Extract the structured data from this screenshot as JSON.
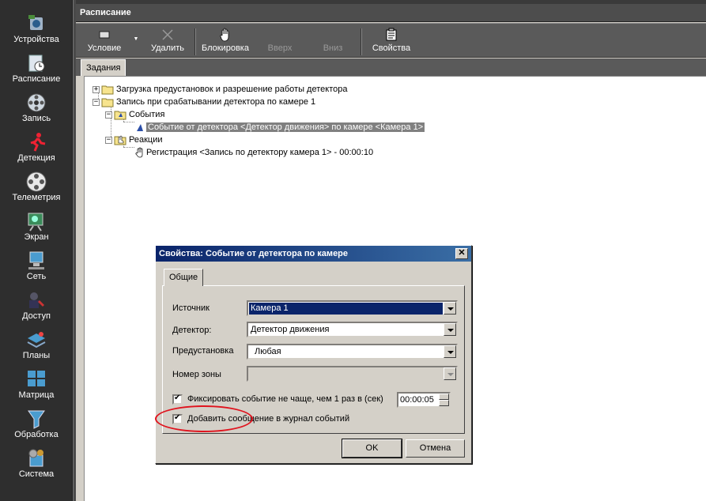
{
  "sidebar": {
    "items": [
      {
        "label": "Устройства",
        "icon": "devices-icon"
      },
      {
        "label": "Расписание",
        "icon": "schedule-icon"
      },
      {
        "label": "Запись",
        "icon": "record-icon"
      },
      {
        "label": "Детекция",
        "icon": "detection-icon"
      },
      {
        "label": "Телеметрия",
        "icon": "telemetry-icon"
      },
      {
        "label": "Экран",
        "icon": "screen-icon"
      },
      {
        "label": "Сеть",
        "icon": "network-icon"
      },
      {
        "label": "Доступ",
        "icon": "access-icon"
      },
      {
        "label": "Планы",
        "icon": "plans-icon"
      },
      {
        "label": "Матрица",
        "icon": "matrix-icon"
      },
      {
        "label": "Обработка",
        "icon": "processing-icon"
      },
      {
        "label": "Система",
        "icon": "system-icon"
      }
    ]
  },
  "window": {
    "title": "Расписание"
  },
  "toolbar": {
    "condition": "Условие",
    "delete": "Удалить",
    "block": "Блокировка",
    "up": "Вверх",
    "down": "Вниз",
    "properties": "Свойства"
  },
  "tabs": {
    "tasks": "Задания"
  },
  "tree": {
    "row1": "Загрузка предустановок и разрешение работы детектора",
    "row2": "Запись при срабатывании детектора по камере  1",
    "events": "События",
    "event1": "Событие от детектора <Детектор движения> по камере <Камера  1>",
    "reactions": "Реакции",
    "reaction1": "Регистрация <Запись по детектору камера 1> - 00:00:10",
    "expand_plus": "+",
    "expand_minus": "−"
  },
  "dialog": {
    "title": "Свойства: Событие от детектора по камере",
    "close": "✕",
    "tab": "Общие",
    "source_label": "Источник",
    "source_value": "Камера  1",
    "detector_label": "Детектор:",
    "detector_value": "Детектор движения",
    "preset_label": "Предустановка",
    "preset_value": "Любая",
    "zone_label": "Номер зоны",
    "zone_value": "",
    "fix_label": "Фиксировать событие не чаще, чем 1 раз в (сек)",
    "fix_checked": true,
    "interval": "00:00:05",
    "journal_label": "Добавить сообщение в журнал событий",
    "journal_checked": true,
    "ok": "OK",
    "cancel": "Отмена"
  },
  "colors": {
    "annotation": "#e0141e",
    "title_active": "#0a246a",
    "selection": "#808080"
  }
}
